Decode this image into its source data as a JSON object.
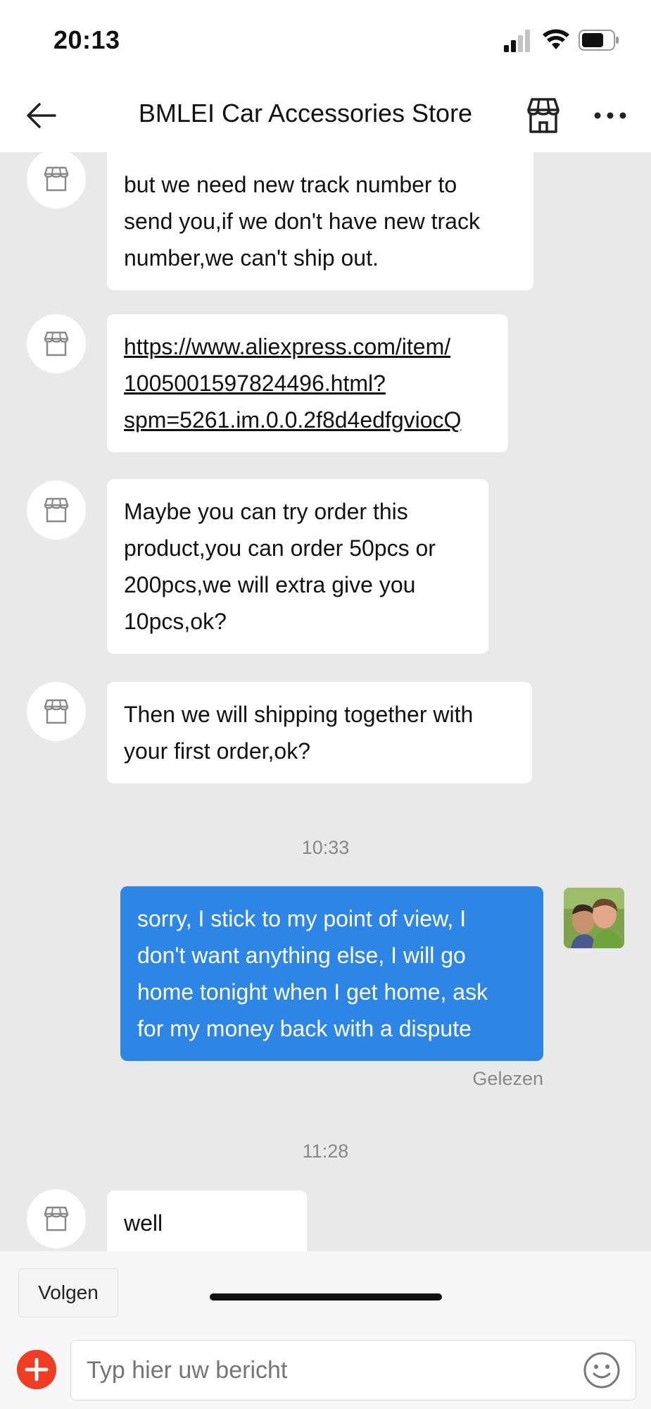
{
  "status_bar": {
    "time": "20:13"
  },
  "header": {
    "title": "BMLEI Car Accessories Store"
  },
  "messages": [
    {
      "text_lines": [
        "but we need new track number to",
        "send you,if we don't have new track",
        "number,we can't ship out."
      ]
    },
    {
      "text_lines": [
        "https://www.aliexpress.com/item/",
        "1005001597824496.html?",
        "spm=5261.im.0.0.2f8d4edfgviocQ"
      ]
    },
    {
      "text_lines": [
        "Maybe you can try order this",
        "product,you can order 50pcs or",
        "200pcs,we will extra give you",
        "10pcs,ok?"
      ]
    },
    {
      "text_lines": [
        "Then we will shipping together with",
        "your first order,ok?"
      ]
    },
    {
      "text_lines": [
        "sorry, I stick to my point of view, I",
        "don't want anything else, I will go",
        "home tonight when I get home, ask",
        "for my money back with a dispute"
      ]
    },
    {
      "text_lines": [
        "well"
      ]
    }
  ],
  "timestamps": [
    "10:33",
    "11:28"
  ],
  "read_status": "Gelezen",
  "follow_label": "Volgen",
  "input_placeholder": "Typ hier uw bericht",
  "icons": [
    "back-arrow-icon",
    "store-icon",
    "more-icon",
    "plus-icon",
    "emoji-icon"
  ],
  "colors": {
    "my_bubble": "#2d86e5",
    "plus_button": "#f03c22"
  }
}
